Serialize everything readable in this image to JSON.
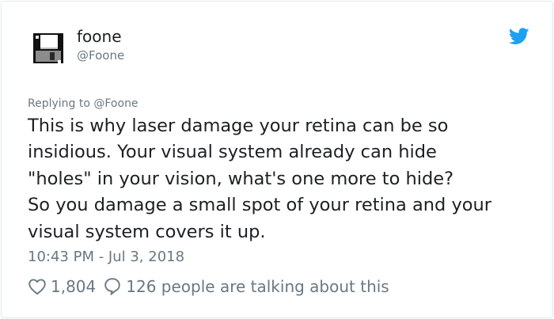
{
  "author": {
    "display_name": "foone",
    "handle": "@Foone",
    "avatar_icon": "floppy-disk-icon"
  },
  "brand_icon": "twitter-bird-icon",
  "reply_context": "Replying to @Foone",
  "tweet_text": "This is why laser damage your retina can be so\ninsidious. Your visual system already can hide\n\"holes\" in your vision, what's one more to hide?\nSo you damage a small spot of your retina and your\nvisual system covers it up.",
  "timestamp": "10:43 PM - Jul 3, 2018",
  "actions": {
    "like_count": "1,804",
    "reply_text": "126 people are talking about this"
  },
  "colors": {
    "brand_blue": "#1da1f2",
    "text": "#1c2022",
    "secondary_text": "#697882",
    "border": "#e1e8ed"
  }
}
